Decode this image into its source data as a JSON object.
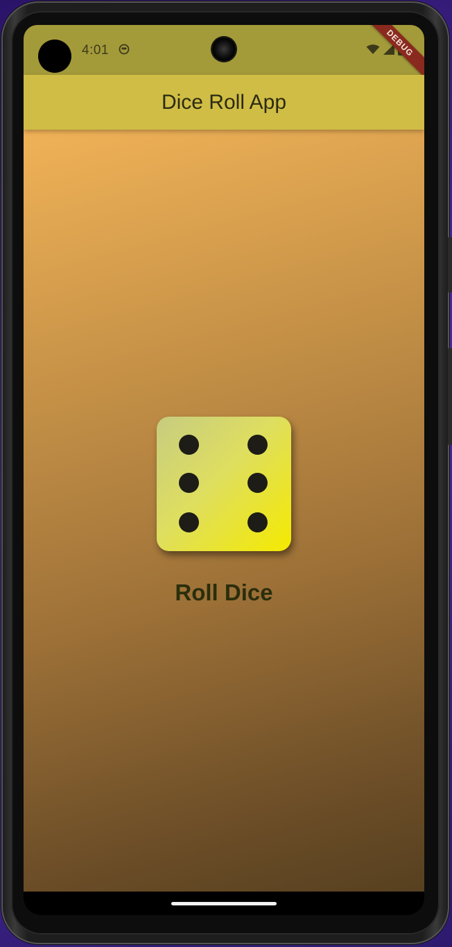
{
  "status_bar": {
    "time": "4:01",
    "notification_icon": "circle-face-icon",
    "wifi_icon": "wifi-icon",
    "signal_icon": "cellular-signal-icon",
    "battery_icon": "battery-icon",
    "debug_banner": "DEBUG"
  },
  "app_bar": {
    "title": "Dice Roll App",
    "color": "#cfbd45"
  },
  "main": {
    "dice": {
      "face_value": 6,
      "icon": "dice-six-icon"
    },
    "roll_button_label": "Roll Dice"
  },
  "colors": {
    "gradient_top": "#f0b257",
    "gradient_bottom": "#574020",
    "dice_start": "#c7cc80",
    "dice_end": "#f5ea00",
    "pip": "#1d1c16"
  }
}
